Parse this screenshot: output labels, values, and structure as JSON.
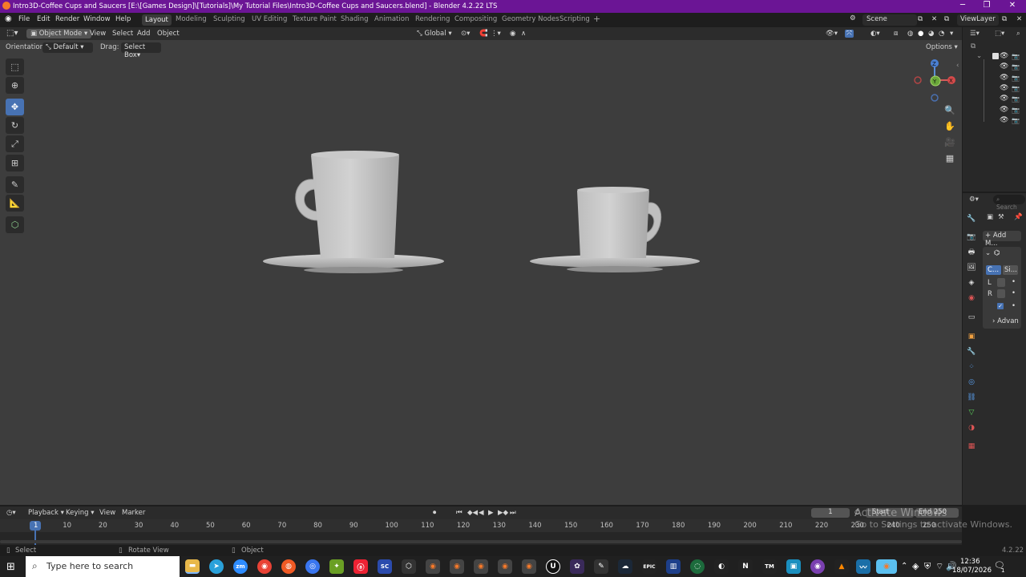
{
  "window": {
    "title": "Intro3D-Coffee Cups and Saucers [E:\\[Games Design]\\[Tutorials]\\My Tutorial Files\\Intro3D-Coffee Cups and Saucers.blend] - Blender 4.2.22 LTS"
  },
  "menu": [
    "File",
    "Edit",
    "Render",
    "Window",
    "Help"
  ],
  "workspaces": [
    "Layout",
    "Modeling",
    "Sculpting",
    "UV Editing",
    "Texture Paint",
    "Shading",
    "Animation",
    "Rendering",
    "Compositing",
    "Geometry Nodes",
    "Scripting"
  ],
  "scene": {
    "label": "Scene",
    "view_layer": "ViewLayer"
  },
  "viewport_header": {
    "mode": "Object Mode",
    "menus": [
      "View",
      "Select",
      "Add",
      "Object"
    ],
    "transform": "Global",
    "orientation_label": "Orientation:",
    "orientation_value": "Default",
    "drag_label": "Drag:",
    "drag_value": "Select Box",
    "options": "Options"
  },
  "gizmo": {
    "z": "Z",
    "y": "Y",
    "x": "X"
  },
  "properties": {
    "search": "Search",
    "add_modifier": "Add M...",
    "tabs": [
      "C...",
      "Si..."
    ],
    "rows": [
      "L",
      "R"
    ],
    "advanced": "Advan"
  },
  "timeline": {
    "menus": [
      "Playback",
      "Keying",
      "View",
      "Marker"
    ],
    "current_frame": "1",
    "start": "Start",
    "end_label": "End",
    "end_value": "250",
    "ticks": [
      "1",
      "10",
      "20",
      "30",
      "40",
      "50",
      "60",
      "70",
      "80",
      "90",
      "100",
      "110",
      "120",
      "130",
      "140",
      "150",
      "160",
      "170",
      "180",
      "190",
      "200",
      "210",
      "220",
      "230",
      "240",
      "250"
    ]
  },
  "statusbar": {
    "select": "Select",
    "rotate": "Rotate View",
    "object": "Object",
    "version": "4.2.22"
  },
  "watermark": {
    "line1": "Activate Windows",
    "line2": "Go to Settings to activate Windows."
  },
  "taskbar": {
    "search_placeholder": "Type here to search",
    "time": "12:36",
    "date": "18/07/2026",
    "notification_count": "1"
  },
  "colors": {
    "titlebar": "#6b1595",
    "accent": "#4772b3",
    "viewport": "#3d3d3d"
  }
}
